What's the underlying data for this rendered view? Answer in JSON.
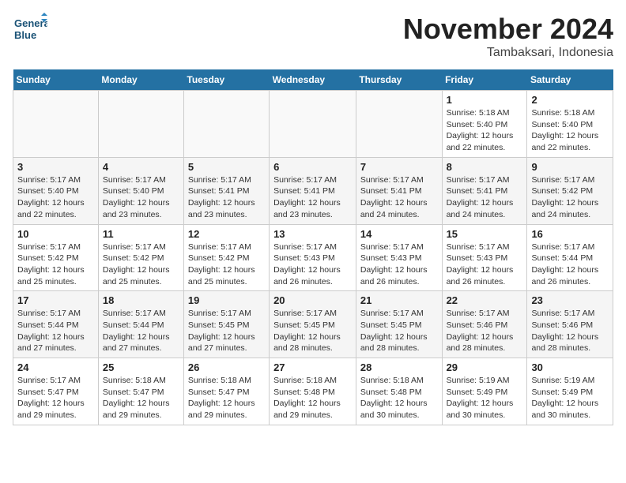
{
  "header": {
    "logo_text_line1": "General",
    "logo_text_line2": "Blue",
    "month_year": "November 2024",
    "location": "Tambaksari, Indonesia"
  },
  "days_of_week": [
    "Sunday",
    "Monday",
    "Tuesday",
    "Wednesday",
    "Thursday",
    "Friday",
    "Saturday"
  ],
  "weeks": [
    [
      {
        "day": "",
        "info": ""
      },
      {
        "day": "",
        "info": ""
      },
      {
        "day": "",
        "info": ""
      },
      {
        "day": "",
        "info": ""
      },
      {
        "day": "",
        "info": ""
      },
      {
        "day": "1",
        "info": "Sunrise: 5:18 AM\nSunset: 5:40 PM\nDaylight: 12 hours and 22 minutes."
      },
      {
        "day": "2",
        "info": "Sunrise: 5:18 AM\nSunset: 5:40 PM\nDaylight: 12 hours and 22 minutes."
      }
    ],
    [
      {
        "day": "3",
        "info": "Sunrise: 5:17 AM\nSunset: 5:40 PM\nDaylight: 12 hours and 22 minutes."
      },
      {
        "day": "4",
        "info": "Sunrise: 5:17 AM\nSunset: 5:40 PM\nDaylight: 12 hours and 23 minutes."
      },
      {
        "day": "5",
        "info": "Sunrise: 5:17 AM\nSunset: 5:41 PM\nDaylight: 12 hours and 23 minutes."
      },
      {
        "day": "6",
        "info": "Sunrise: 5:17 AM\nSunset: 5:41 PM\nDaylight: 12 hours and 23 minutes."
      },
      {
        "day": "7",
        "info": "Sunrise: 5:17 AM\nSunset: 5:41 PM\nDaylight: 12 hours and 24 minutes."
      },
      {
        "day": "8",
        "info": "Sunrise: 5:17 AM\nSunset: 5:41 PM\nDaylight: 12 hours and 24 minutes."
      },
      {
        "day": "9",
        "info": "Sunrise: 5:17 AM\nSunset: 5:42 PM\nDaylight: 12 hours and 24 minutes."
      }
    ],
    [
      {
        "day": "10",
        "info": "Sunrise: 5:17 AM\nSunset: 5:42 PM\nDaylight: 12 hours and 25 minutes."
      },
      {
        "day": "11",
        "info": "Sunrise: 5:17 AM\nSunset: 5:42 PM\nDaylight: 12 hours and 25 minutes."
      },
      {
        "day": "12",
        "info": "Sunrise: 5:17 AM\nSunset: 5:42 PM\nDaylight: 12 hours and 25 minutes."
      },
      {
        "day": "13",
        "info": "Sunrise: 5:17 AM\nSunset: 5:43 PM\nDaylight: 12 hours and 26 minutes."
      },
      {
        "day": "14",
        "info": "Sunrise: 5:17 AM\nSunset: 5:43 PM\nDaylight: 12 hours and 26 minutes."
      },
      {
        "day": "15",
        "info": "Sunrise: 5:17 AM\nSunset: 5:43 PM\nDaylight: 12 hours and 26 minutes."
      },
      {
        "day": "16",
        "info": "Sunrise: 5:17 AM\nSunset: 5:44 PM\nDaylight: 12 hours and 26 minutes."
      }
    ],
    [
      {
        "day": "17",
        "info": "Sunrise: 5:17 AM\nSunset: 5:44 PM\nDaylight: 12 hours and 27 minutes."
      },
      {
        "day": "18",
        "info": "Sunrise: 5:17 AM\nSunset: 5:44 PM\nDaylight: 12 hours and 27 minutes."
      },
      {
        "day": "19",
        "info": "Sunrise: 5:17 AM\nSunset: 5:45 PM\nDaylight: 12 hours and 27 minutes."
      },
      {
        "day": "20",
        "info": "Sunrise: 5:17 AM\nSunset: 5:45 PM\nDaylight: 12 hours and 28 minutes."
      },
      {
        "day": "21",
        "info": "Sunrise: 5:17 AM\nSunset: 5:45 PM\nDaylight: 12 hours and 28 minutes."
      },
      {
        "day": "22",
        "info": "Sunrise: 5:17 AM\nSunset: 5:46 PM\nDaylight: 12 hours and 28 minutes."
      },
      {
        "day": "23",
        "info": "Sunrise: 5:17 AM\nSunset: 5:46 PM\nDaylight: 12 hours and 28 minutes."
      }
    ],
    [
      {
        "day": "24",
        "info": "Sunrise: 5:17 AM\nSunset: 5:47 PM\nDaylight: 12 hours and 29 minutes."
      },
      {
        "day": "25",
        "info": "Sunrise: 5:18 AM\nSunset: 5:47 PM\nDaylight: 12 hours and 29 minutes."
      },
      {
        "day": "26",
        "info": "Sunrise: 5:18 AM\nSunset: 5:47 PM\nDaylight: 12 hours and 29 minutes."
      },
      {
        "day": "27",
        "info": "Sunrise: 5:18 AM\nSunset: 5:48 PM\nDaylight: 12 hours and 29 minutes."
      },
      {
        "day": "28",
        "info": "Sunrise: 5:18 AM\nSunset: 5:48 PM\nDaylight: 12 hours and 30 minutes."
      },
      {
        "day": "29",
        "info": "Sunrise: 5:19 AM\nSunset: 5:49 PM\nDaylight: 12 hours and 30 minutes."
      },
      {
        "day": "30",
        "info": "Sunrise: 5:19 AM\nSunset: 5:49 PM\nDaylight: 12 hours and 30 minutes."
      }
    ]
  ]
}
